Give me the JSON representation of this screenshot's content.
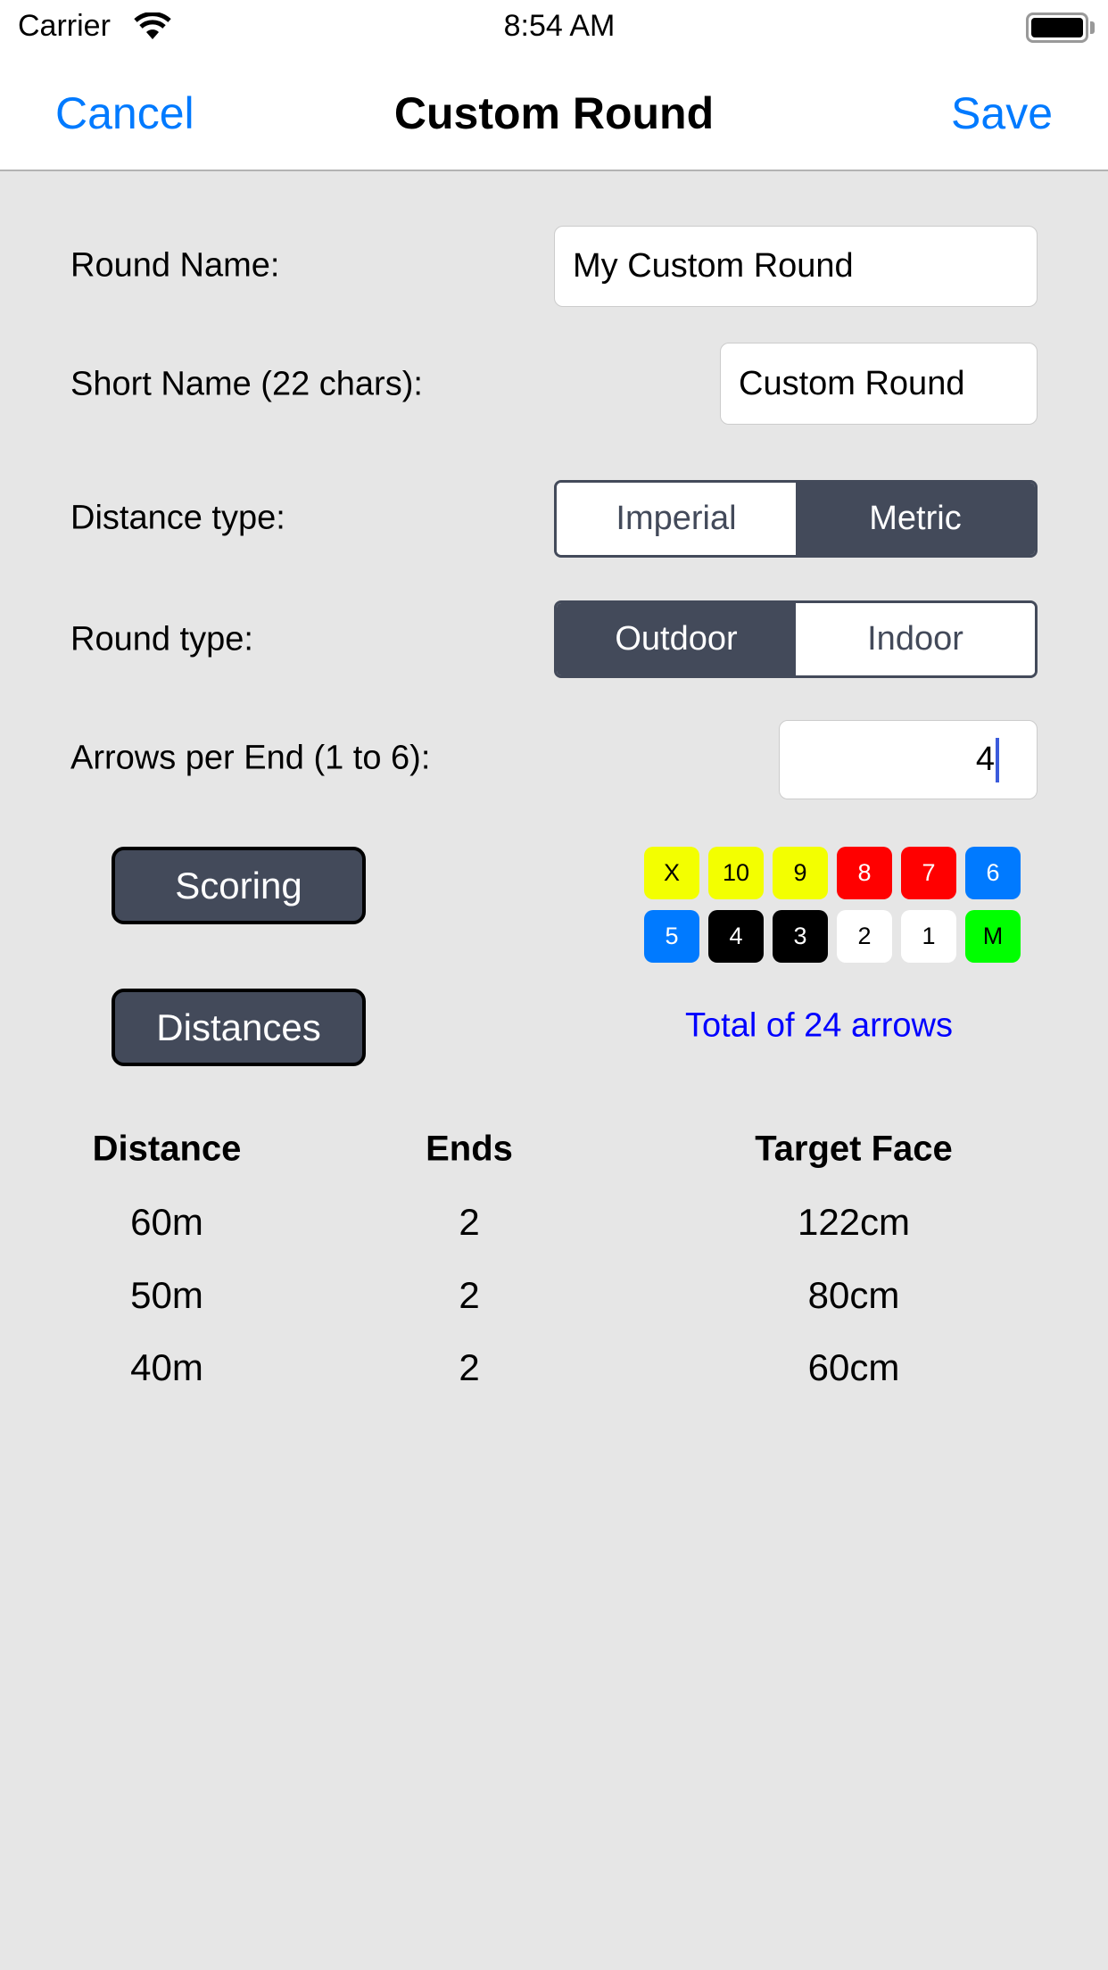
{
  "status_bar": {
    "carrier": "Carrier",
    "time": "8:54 AM",
    "wifi_icon": "wifi-icon",
    "battery_icon": "battery-icon"
  },
  "nav": {
    "cancel": "Cancel",
    "title": "Custom Round",
    "save": "Save"
  },
  "form": {
    "round_name": {
      "label": "Round Name:",
      "value": "My Custom Round"
    },
    "short_name": {
      "label": "Short Name (22 chars):",
      "value": "Custom Round"
    },
    "distance_type": {
      "label": "Distance type:",
      "options": [
        "Imperial",
        "Metric"
      ],
      "selected": "Metric"
    },
    "round_type": {
      "label": "Round type:",
      "options": [
        "Outdoor",
        "Indoor"
      ],
      "selected": "Outdoor"
    },
    "arrows_per_end": {
      "label": "Arrows per End (1 to 6):",
      "value": "4"
    }
  },
  "buttons": {
    "scoring": "Scoring",
    "distances": "Distances"
  },
  "scores": [
    {
      "label": "X",
      "bg": "#f3ff00",
      "fg": "#000000"
    },
    {
      "label": "10",
      "bg": "#f3ff00",
      "fg": "#000000"
    },
    {
      "label": "9",
      "bg": "#f3ff00",
      "fg": "#000000"
    },
    {
      "label": "8",
      "bg": "#ff0000",
      "fg": "#ffffff"
    },
    {
      "label": "7",
      "bg": "#ff0000",
      "fg": "#ffffff"
    },
    {
      "label": "6",
      "bg": "#007aff",
      "fg": "#ffffff"
    },
    {
      "label": "5",
      "bg": "#007aff",
      "fg": "#ffffff"
    },
    {
      "label": "4",
      "bg": "#000000",
      "fg": "#ffffff"
    },
    {
      "label": "3",
      "bg": "#000000",
      "fg": "#ffffff"
    },
    {
      "label": "2",
      "bg": "#ffffff",
      "fg": "#000000"
    },
    {
      "label": "1",
      "bg": "#ffffff",
      "fg": "#000000"
    },
    {
      "label": "M",
      "bg": "#00ff00",
      "fg": "#000000"
    }
  ],
  "total": "Total of 24 arrows",
  "table": {
    "headers": [
      "Distance",
      "Ends",
      "Target Face"
    ],
    "rows": [
      [
        "60m",
        "2",
        "122cm"
      ],
      [
        "50m",
        "2",
        "80cm"
      ],
      [
        "40m",
        "2",
        "60cm"
      ]
    ]
  },
  "colors": {
    "accent": "#007aff",
    "control": "#434a5a",
    "total_text": "#0000ff",
    "background": "#e6e6e6"
  }
}
